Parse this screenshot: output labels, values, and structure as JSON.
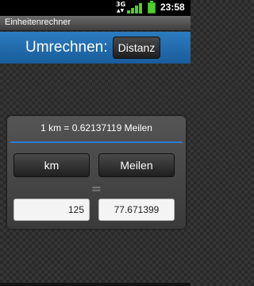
{
  "status_bar": {
    "network": "3G",
    "time": "23:58",
    "signal_level": 1.0,
    "battery_level": 1.0,
    "accent_color": "#4fcf2e"
  },
  "app": {
    "title": "Einheitenrechner"
  },
  "header": {
    "label": "Umrechnen:",
    "category": "Distanz",
    "color": "#2b7cc0"
  },
  "converter": {
    "result": "1 km = 0.62137119 Meilen",
    "from_unit": "km",
    "to_unit": "Meilen",
    "equals_sign": "=",
    "input_value": "125",
    "output_value": "77.671399",
    "divider_color": "#2f7bd0"
  }
}
